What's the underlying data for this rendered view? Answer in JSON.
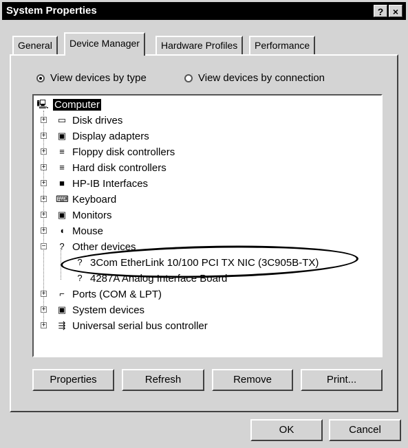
{
  "window": {
    "title": "System Properties",
    "help_label": "?",
    "close_label": "×"
  },
  "tabs": [
    {
      "label": "General",
      "active": false
    },
    {
      "label": "Device Manager",
      "active": true
    },
    {
      "label": "Hardware Profiles",
      "active": false
    },
    {
      "label": "Performance",
      "active": false
    }
  ],
  "view_options": {
    "by_type": {
      "label": "View devices by type",
      "selected": true
    },
    "by_connection": {
      "label": "View devices by connection",
      "selected": false
    }
  },
  "tree": {
    "root": {
      "label": "Computer",
      "icon": "computer-icon",
      "selected": true
    },
    "items": [
      {
        "label": "Disk drives",
        "icon": "disk-drive-icon",
        "expander": "+"
      },
      {
        "label": "Display adapters",
        "icon": "monitor-icon",
        "expander": "+"
      },
      {
        "label": "Floppy disk controllers",
        "icon": "floppy-controller-icon",
        "expander": "+"
      },
      {
        "label": "Hard disk controllers",
        "icon": "hard-disk-controller-icon",
        "expander": "+"
      },
      {
        "label": "HP-IB Interfaces",
        "icon": "chip-icon",
        "expander": "+"
      },
      {
        "label": "Keyboard",
        "icon": "keyboard-icon",
        "expander": "+"
      },
      {
        "label": "Monitors",
        "icon": "monitor-icon",
        "expander": "+"
      },
      {
        "label": "Mouse",
        "icon": "mouse-icon",
        "expander": "+"
      },
      {
        "label": "Other devices",
        "icon": "question-icon",
        "expander": "−"
      },
      {
        "label": "3Com EtherLink 10/100 PCI TX NIC (3C905B-TX)",
        "icon": "question-icon",
        "child": true
      },
      {
        "label": "4287A Analog Interface Board",
        "icon": "question-icon",
        "child": true
      },
      {
        "label": "Ports (COM & LPT)",
        "icon": "port-icon",
        "expander": "+"
      },
      {
        "label": "System devices",
        "icon": "system-device-icon",
        "expander": "+"
      },
      {
        "label": "Universal serial bus controller",
        "icon": "usb-icon",
        "expander": "+"
      }
    ]
  },
  "panel_buttons": {
    "properties": "Properties",
    "refresh": "Refresh",
    "remove": "Remove",
    "print": "Print..."
  },
  "dialog_buttons": {
    "ok": "OK",
    "cancel": "Cancel"
  }
}
